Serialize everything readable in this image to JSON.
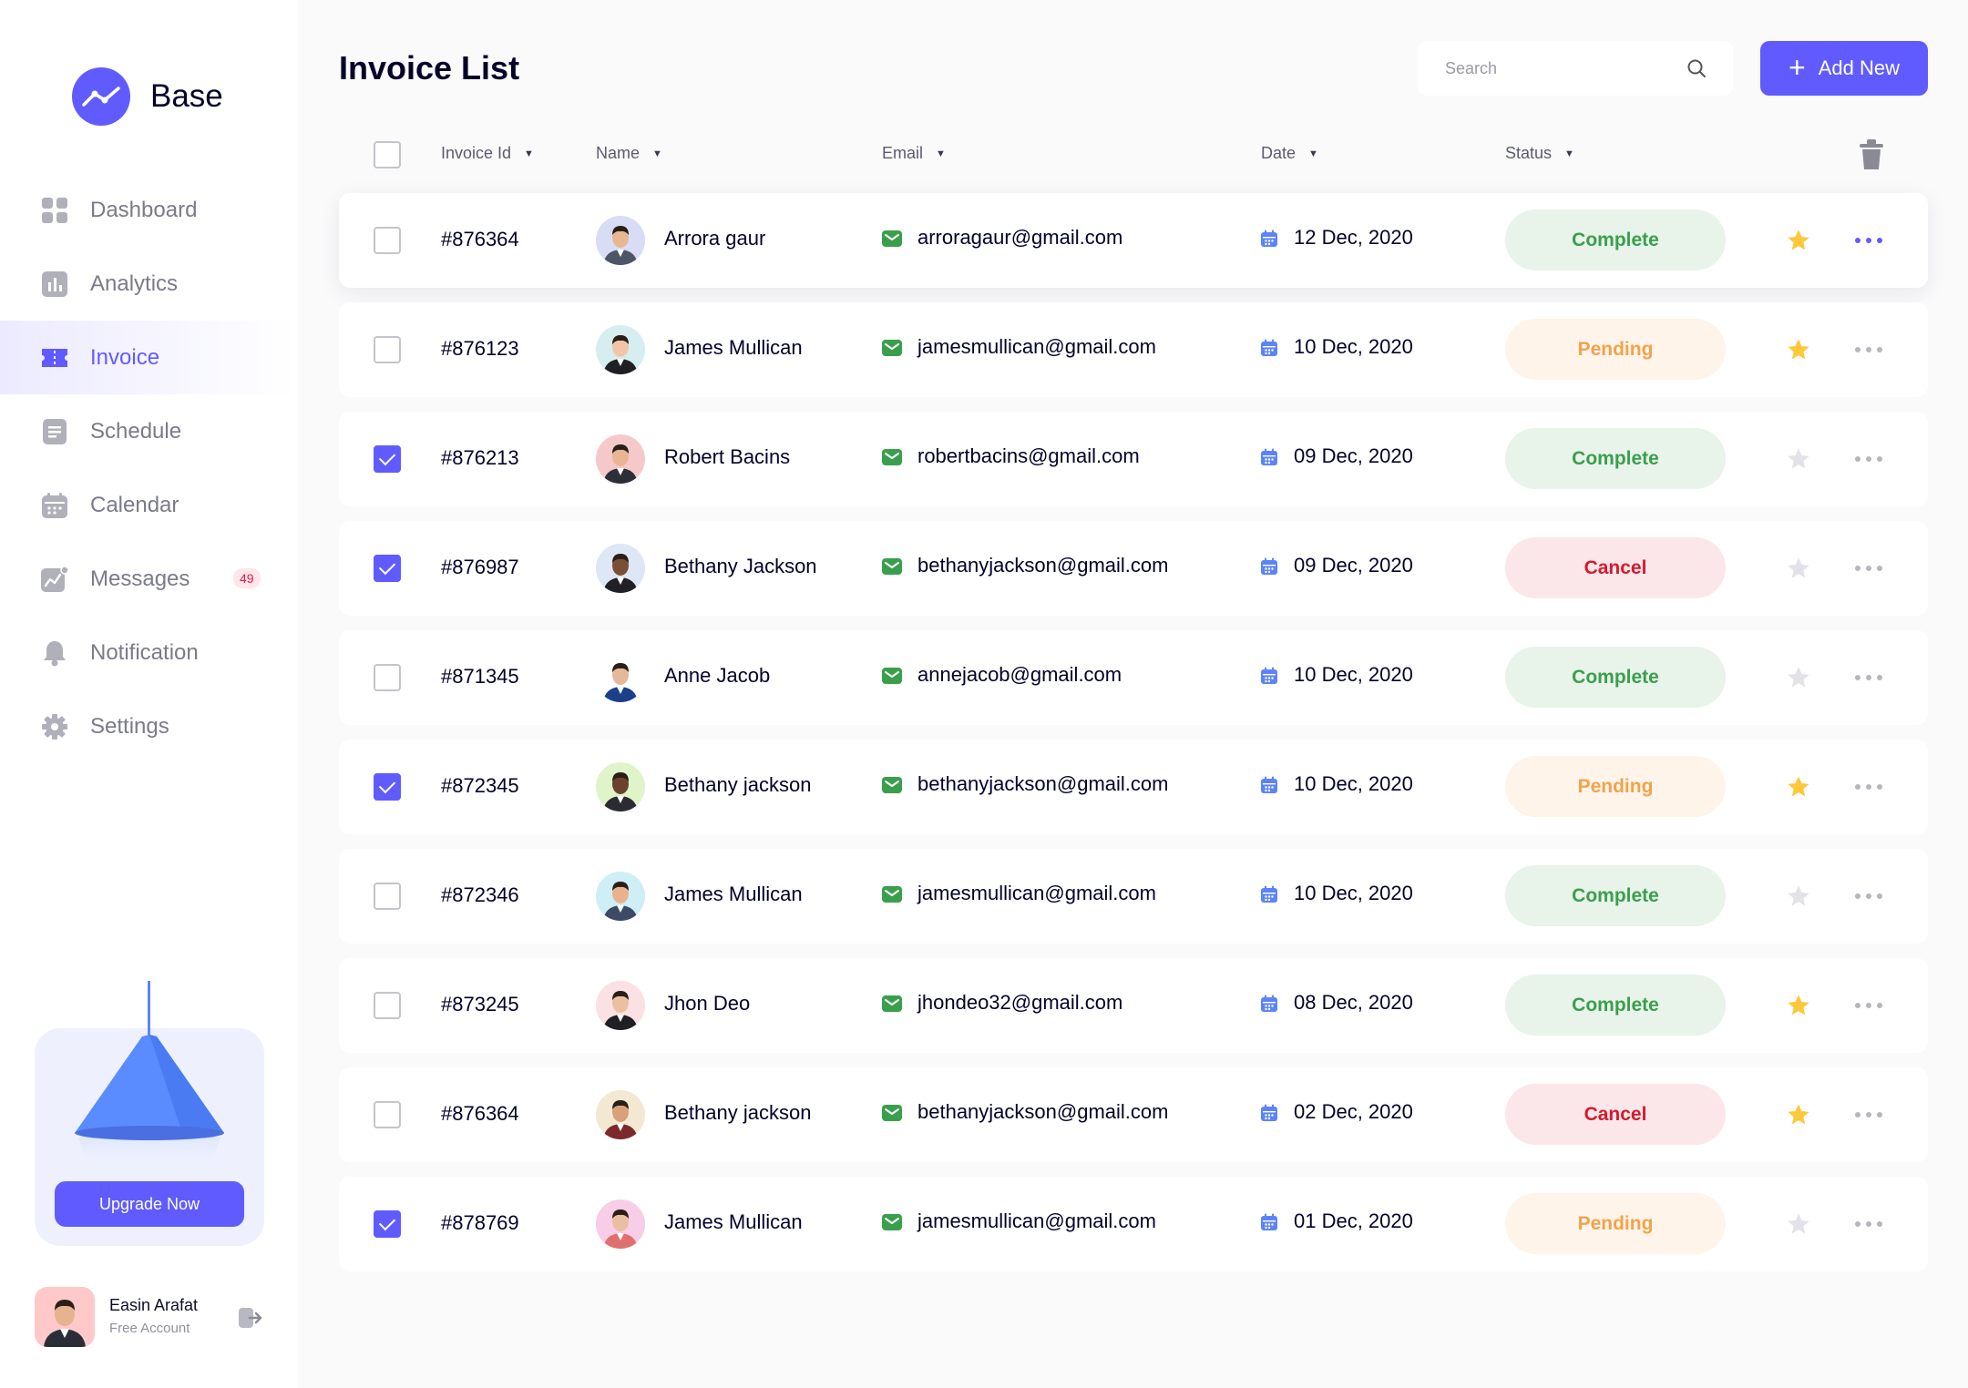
{
  "brand": {
    "name": "Base"
  },
  "colors": {
    "accent": "#605bff",
    "complete": "#3a9f4d",
    "pending": "#f2a34a",
    "cancel": "#d41b2c",
    "star_active": "#ffc83a",
    "star_inactive": "#e2e2e8"
  },
  "sidebar": {
    "items": [
      {
        "label": "Dashboard",
        "icon": "grid-icon",
        "active": false
      },
      {
        "label": "Analytics",
        "icon": "chart-bars-icon",
        "active": false
      },
      {
        "label": "Invoice",
        "icon": "ticket-icon",
        "active": true
      },
      {
        "label": "Schedule",
        "icon": "document-icon",
        "active": false
      },
      {
        "label": "Calendar",
        "icon": "calendar-icon",
        "active": false
      },
      {
        "label": "Messages",
        "icon": "trend-chart-icon",
        "active": false,
        "badge": "49"
      },
      {
        "label": "Notification",
        "icon": "bell-icon",
        "active": false
      },
      {
        "label": "Settings",
        "icon": "gear-icon",
        "active": false
      }
    ],
    "upgrade_label": "Upgrade Now",
    "user": {
      "name": "Easin Arafat",
      "plan": "Free Account"
    }
  },
  "header": {
    "title": "Invoice List",
    "search_placeholder": "Search",
    "add_label": "Add New"
  },
  "table": {
    "columns": [
      "Invoice Id",
      "Name",
      "Email",
      "Date",
      "Status"
    ],
    "rows": [
      {
        "id": "#876364",
        "name": "Arrora gaur",
        "email": "arroragaur@gmail.com",
        "date": "12 Dec, 2020",
        "status": "Complete",
        "checked": false,
        "starred": true,
        "more_active": true,
        "avatar_bg": "#d9dcf5",
        "shirt": "#4d5566",
        "skin": "#e8b893"
      },
      {
        "id": "#876123",
        "name": "James Mullican",
        "email": "jamesmullican@gmail.com",
        "date": "10 Dec, 2020",
        "status": "Pending",
        "checked": false,
        "starred": true,
        "more_active": false,
        "avatar_bg": "#d6eef0",
        "shirt": "#1f1f24",
        "skin": "#f2c5a8"
      },
      {
        "id": "#876213",
        "name": "Robert Bacins",
        "email": "robertbacins@gmail.com",
        "date": "09 Dec, 2020",
        "status": "Complete",
        "checked": true,
        "starred": false,
        "more_active": false,
        "avatar_bg": "#f5c9c9",
        "shirt": "#2d2f38",
        "skin": "#e9b592"
      },
      {
        "id": "#876987",
        "name": "Bethany Jackson",
        "email": "bethanyjackson@gmail.com",
        "date": "09 Dec, 2020",
        "status": "Cancel",
        "checked": true,
        "starred": false,
        "more_active": false,
        "avatar_bg": "#dde7f5",
        "shirt": "#202026",
        "skin": "#7a4f36"
      },
      {
        "id": "#871345",
        "name": "Anne Jacob",
        "email": "annejacob@gmail.com",
        "date": "10 Dec, 2020",
        "status": "Complete",
        "checked": false,
        "starred": false,
        "more_active": false,
        "avatar_bg": "#ffffff",
        "shirt": "#1c3f8a",
        "skin": "#e5b89a"
      },
      {
        "id": "#872345",
        "name": "Bethany jackson",
        "email": "bethanyjackson@gmail.com",
        "date": "10 Dec, 2020",
        "status": "Pending",
        "checked": true,
        "starred": true,
        "more_active": false,
        "avatar_bg": "#dff5c9",
        "shirt": "#2b2b33",
        "skin": "#6a432e"
      },
      {
        "id": "#872346",
        "name": "James Mullican",
        "email": "jamesmullican@gmail.com",
        "date": "10 Dec, 2020",
        "status": "Complete",
        "checked": false,
        "starred": false,
        "more_active": false,
        "avatar_bg": "#cfeef5",
        "shirt": "#3d4a66",
        "skin": "#e8b38c"
      },
      {
        "id": "#873245",
        "name": "Jhon Deo",
        "email": "jhondeo32@gmail.com",
        "date": "08 Dec, 2020",
        "status": "Complete",
        "checked": false,
        "starred": true,
        "more_active": false,
        "avatar_bg": "#fbe0e4",
        "shirt": "#1f1f24",
        "skin": "#edbfa1"
      },
      {
        "id": "#876364",
        "name": "Bethany jackson",
        "email": "bethanyjackson@gmail.com",
        "date": "02 Dec, 2020",
        "status": "Cancel",
        "checked": false,
        "starred": true,
        "more_active": false,
        "avatar_bg": "#f3e9d2",
        "shirt": "#7a2a2a",
        "skin": "#d9a07c"
      },
      {
        "id": "#878769",
        "name": "James Mullican",
        "email": "jamesmullican@gmail.com",
        "date": "01 Dec, 2020",
        "status": "Pending",
        "checked": true,
        "starred": false,
        "more_active": false,
        "avatar_bg": "#f8cde6",
        "shirt": "#e07070",
        "skin": "#eabf9f"
      }
    ]
  }
}
